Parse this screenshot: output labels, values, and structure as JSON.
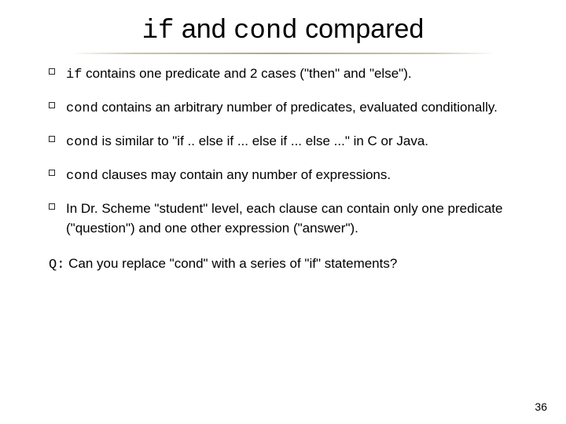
{
  "title": {
    "code1": "if",
    "mid": " and ",
    "code2": "cond",
    "tail": " compared"
  },
  "bullets": [
    {
      "lead_code": "if",
      "text": " contains one predicate and 2 cases (\"then\" and \"else\")."
    },
    {
      "lead_code": "cond",
      "text": " contains an arbitrary number of predicates, evaluated conditionally."
    },
    {
      "lead_code": "cond",
      "text": " is similar to \"if .. else if ... else if ... else ...\" in C or Java."
    },
    {
      "lead_code": "cond",
      "text": " clauses may contain any number of expressions."
    },
    {
      "lead_code": "",
      "text": "In Dr. Scheme \"student\" level, each clause can contain only one predicate (\"question\") and one other expression (\"answer\")."
    }
  ],
  "question": {
    "label": "Q:",
    "text": "Can you replace \"cond\" with a series of \"if\" statements?"
  },
  "page_number": "36"
}
